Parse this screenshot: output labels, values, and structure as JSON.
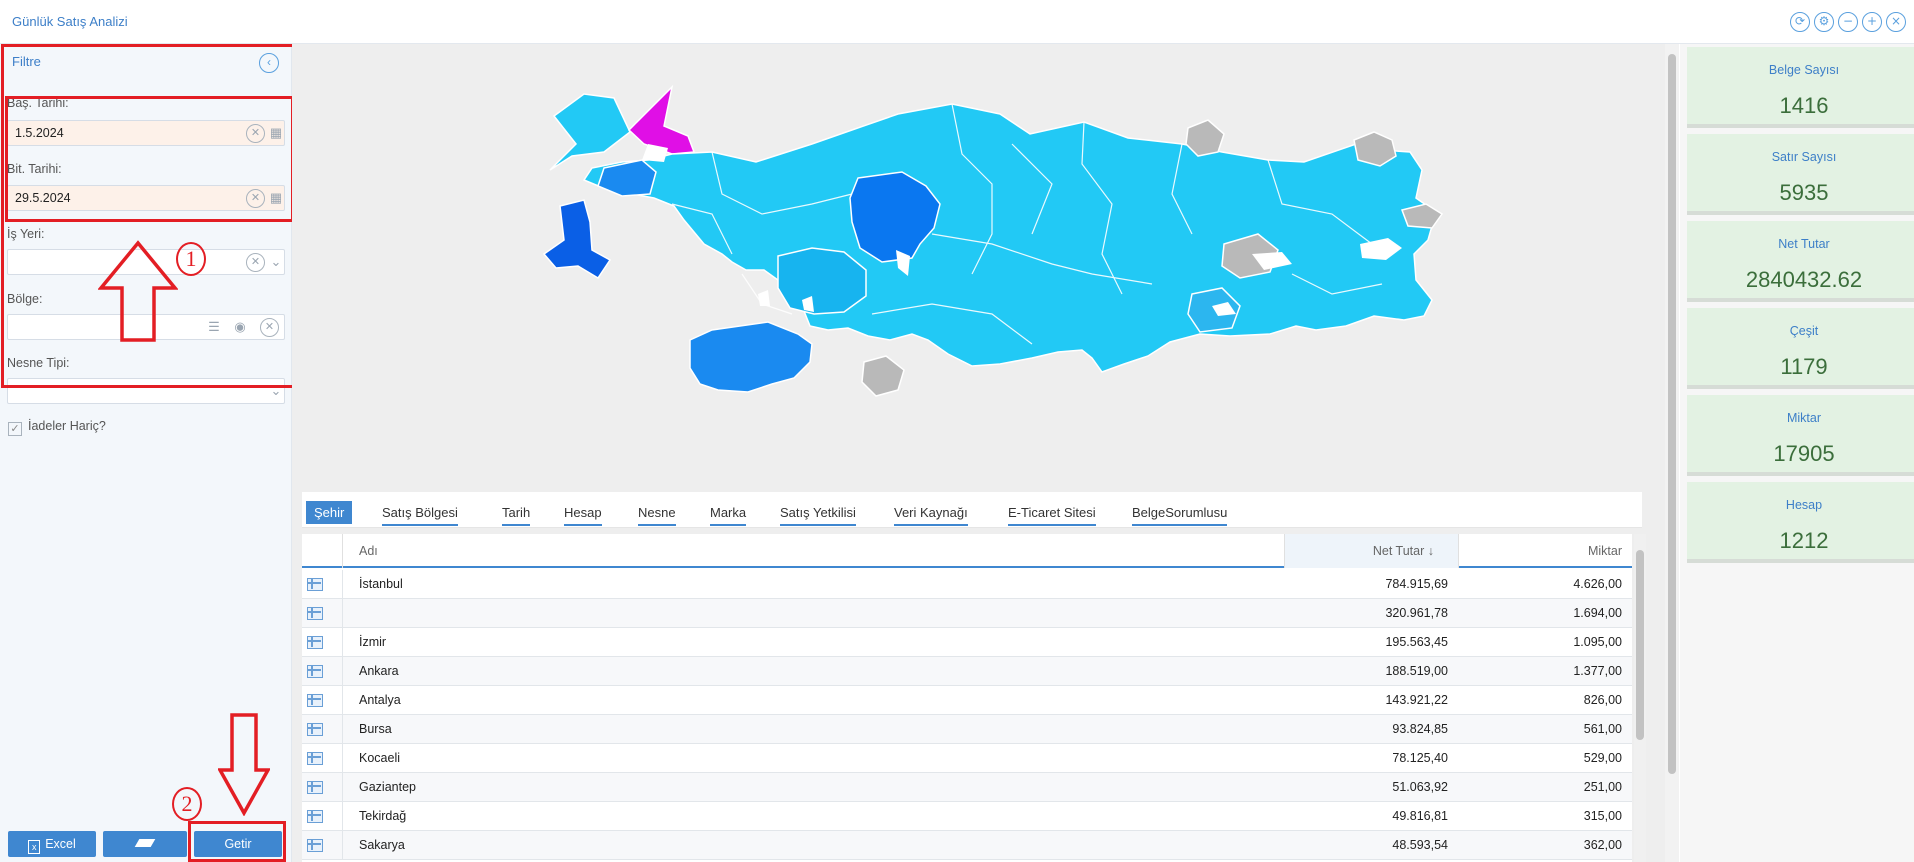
{
  "window": {
    "title": "Günlük Satış Analizi"
  },
  "filter": {
    "title": "Filtre",
    "start_label": "Baş. Tarihi:",
    "start_value": "1.5.2024",
    "end_label": "Bit. Tarihi:",
    "end_value": "29.5.2024",
    "workplace_label": "İş Yeri:",
    "region_label": "Bölge:",
    "object_type_label": "Nesne Tipi:",
    "returns_excluded_label": "İadeler Hariç?"
  },
  "annotations": {
    "marker1": "1",
    "marker2": "2"
  },
  "bottom": {
    "excel_label": "Excel",
    "get_label": "Getir"
  },
  "tabs": [
    "Şehir",
    "Satış Bölgesi",
    "Tarih",
    "Hesap",
    "Nesne",
    "Marka",
    "Satış Yetkilisi",
    "Veri Kaynağı",
    "E-Ticaret Sitesi",
    "BelgeSorumlusu"
  ],
  "grid": {
    "columns": {
      "name": "Adı",
      "net": "Net Tutar",
      "qty": "Miktar"
    },
    "rows": [
      {
        "name": "İstanbul",
        "net": "784.915,69",
        "qty": "4.626,00"
      },
      {
        "name": "",
        "net": "320.961,78",
        "qty": "1.694,00"
      },
      {
        "name": "İzmir",
        "net": "195.563,45",
        "qty": "1.095,00"
      },
      {
        "name": "Ankara",
        "net": "188.519,00",
        "qty": "1.377,00"
      },
      {
        "name": "Antalya",
        "net": "143.921,22",
        "qty": "826,00"
      },
      {
        "name": "Bursa",
        "net": "93.824,85",
        "qty": "561,00"
      },
      {
        "name": "Kocaeli",
        "net": "78.125,40",
        "qty": "529,00"
      },
      {
        "name": "Gaziantep",
        "net": "51.063,92",
        "qty": "251,00"
      },
      {
        "name": "Tekirdağ",
        "net": "49.816,81",
        "qty": "315,00"
      },
      {
        "name": "Sakarya",
        "net": "48.593,54",
        "qty": "362,00"
      }
    ]
  },
  "kpis": [
    {
      "label": "Belge Sayısı",
      "value": "1416"
    },
    {
      "label": "Satır Sayısı",
      "value": "5935"
    },
    {
      "label": "Net Tutar",
      "value": "2840432.62"
    },
    {
      "label": "Çeşit",
      "value": "1179"
    },
    {
      "label": "Miktar",
      "value": "17905"
    },
    {
      "label": "Hesap",
      "value": "1212"
    }
  ],
  "colors": {
    "accent": "#3f87d0",
    "annotation": "#e31e24",
    "kpi_bg": "#e3f2e3",
    "map_base": "#22c9f5",
    "map_dark": "#0a77f0",
    "map_top": "#e00fe6",
    "map_nodata": "#b9b9b9"
  }
}
